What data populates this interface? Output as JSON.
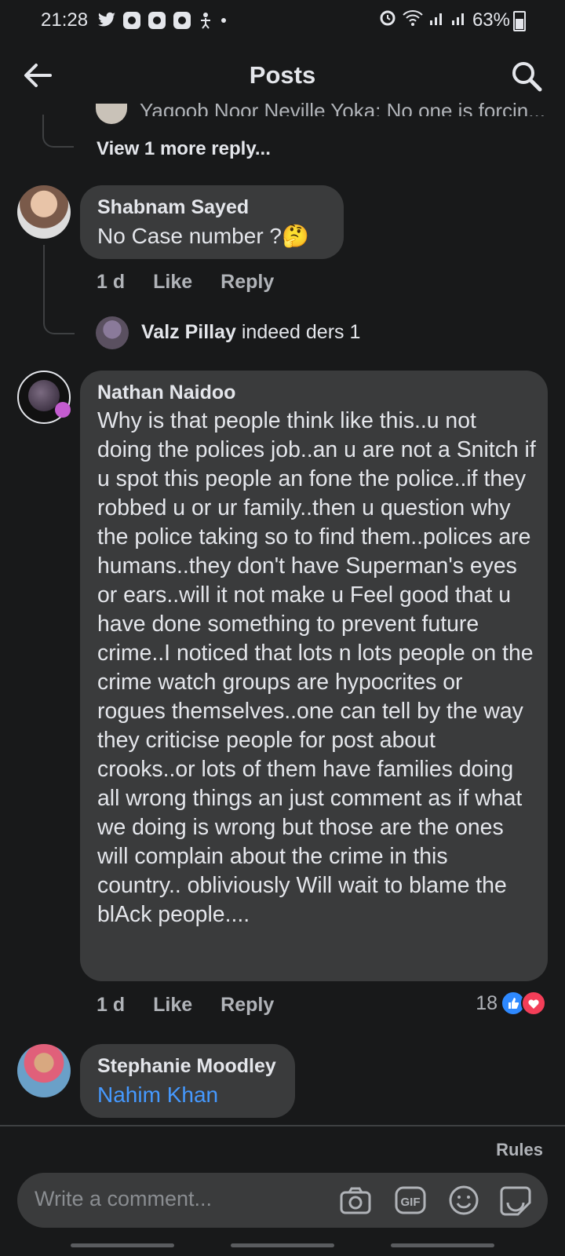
{
  "status": {
    "time": "21:28",
    "battery": "63%"
  },
  "header": {
    "title": "Posts"
  },
  "truncated_reply": {
    "text": "Yaqoob Noor Neville Yoka: No one is forcin..."
  },
  "view_more": "View 1 more reply...",
  "comments": [
    {
      "name": "Shabnam Sayed",
      "text": "No Case number ?🤔",
      "time": "1 d",
      "like": "Like",
      "reply": "Reply"
    },
    {
      "name": "Nathan Naidoo",
      "text": "Why is that people think like this..u not doing the polices job..an u are not a Snitch if u spot this people an fone the police..if they robbed u or ur family..then u question why the police taking so to find them..polices are humans..they don't have Superman's eyes or ears..will it not make u Feel good that u have done something to prevent future crime..I noticed that lots n lots people on the crime watch groups are hypocrites or rogues themselves..one can tell by the way they criticise people for post about crooks..or lots of them have families doing all wrong things an just comment as if what we doing is wrong but those are the ones will complain about the crime in this country.. obliviously Will wait to blame the blAck people....",
      "time": "1 d",
      "like": "Like",
      "reply": "Reply",
      "reactions": "18"
    },
    {
      "name": "Stephanie Moodley",
      "text": "Nahim Khan"
    }
  ],
  "nested_reply": {
    "name": "Valz Pillay",
    "text": "indeed ders 1"
  },
  "composer": {
    "rules": "Rules",
    "placeholder": "Write a comment..."
  },
  "colors": {
    "accent": "#2e89ff",
    "link": "#4599ff",
    "love": "#f33e58",
    "bubble": "#3a3b3c",
    "bg": "#18191a"
  },
  "icons": [
    "twitter-icon",
    "camera-icon",
    "gif-icon",
    "emoji-icon",
    "sticker-icon",
    "search-icon",
    "back-arrow-icon"
  ]
}
